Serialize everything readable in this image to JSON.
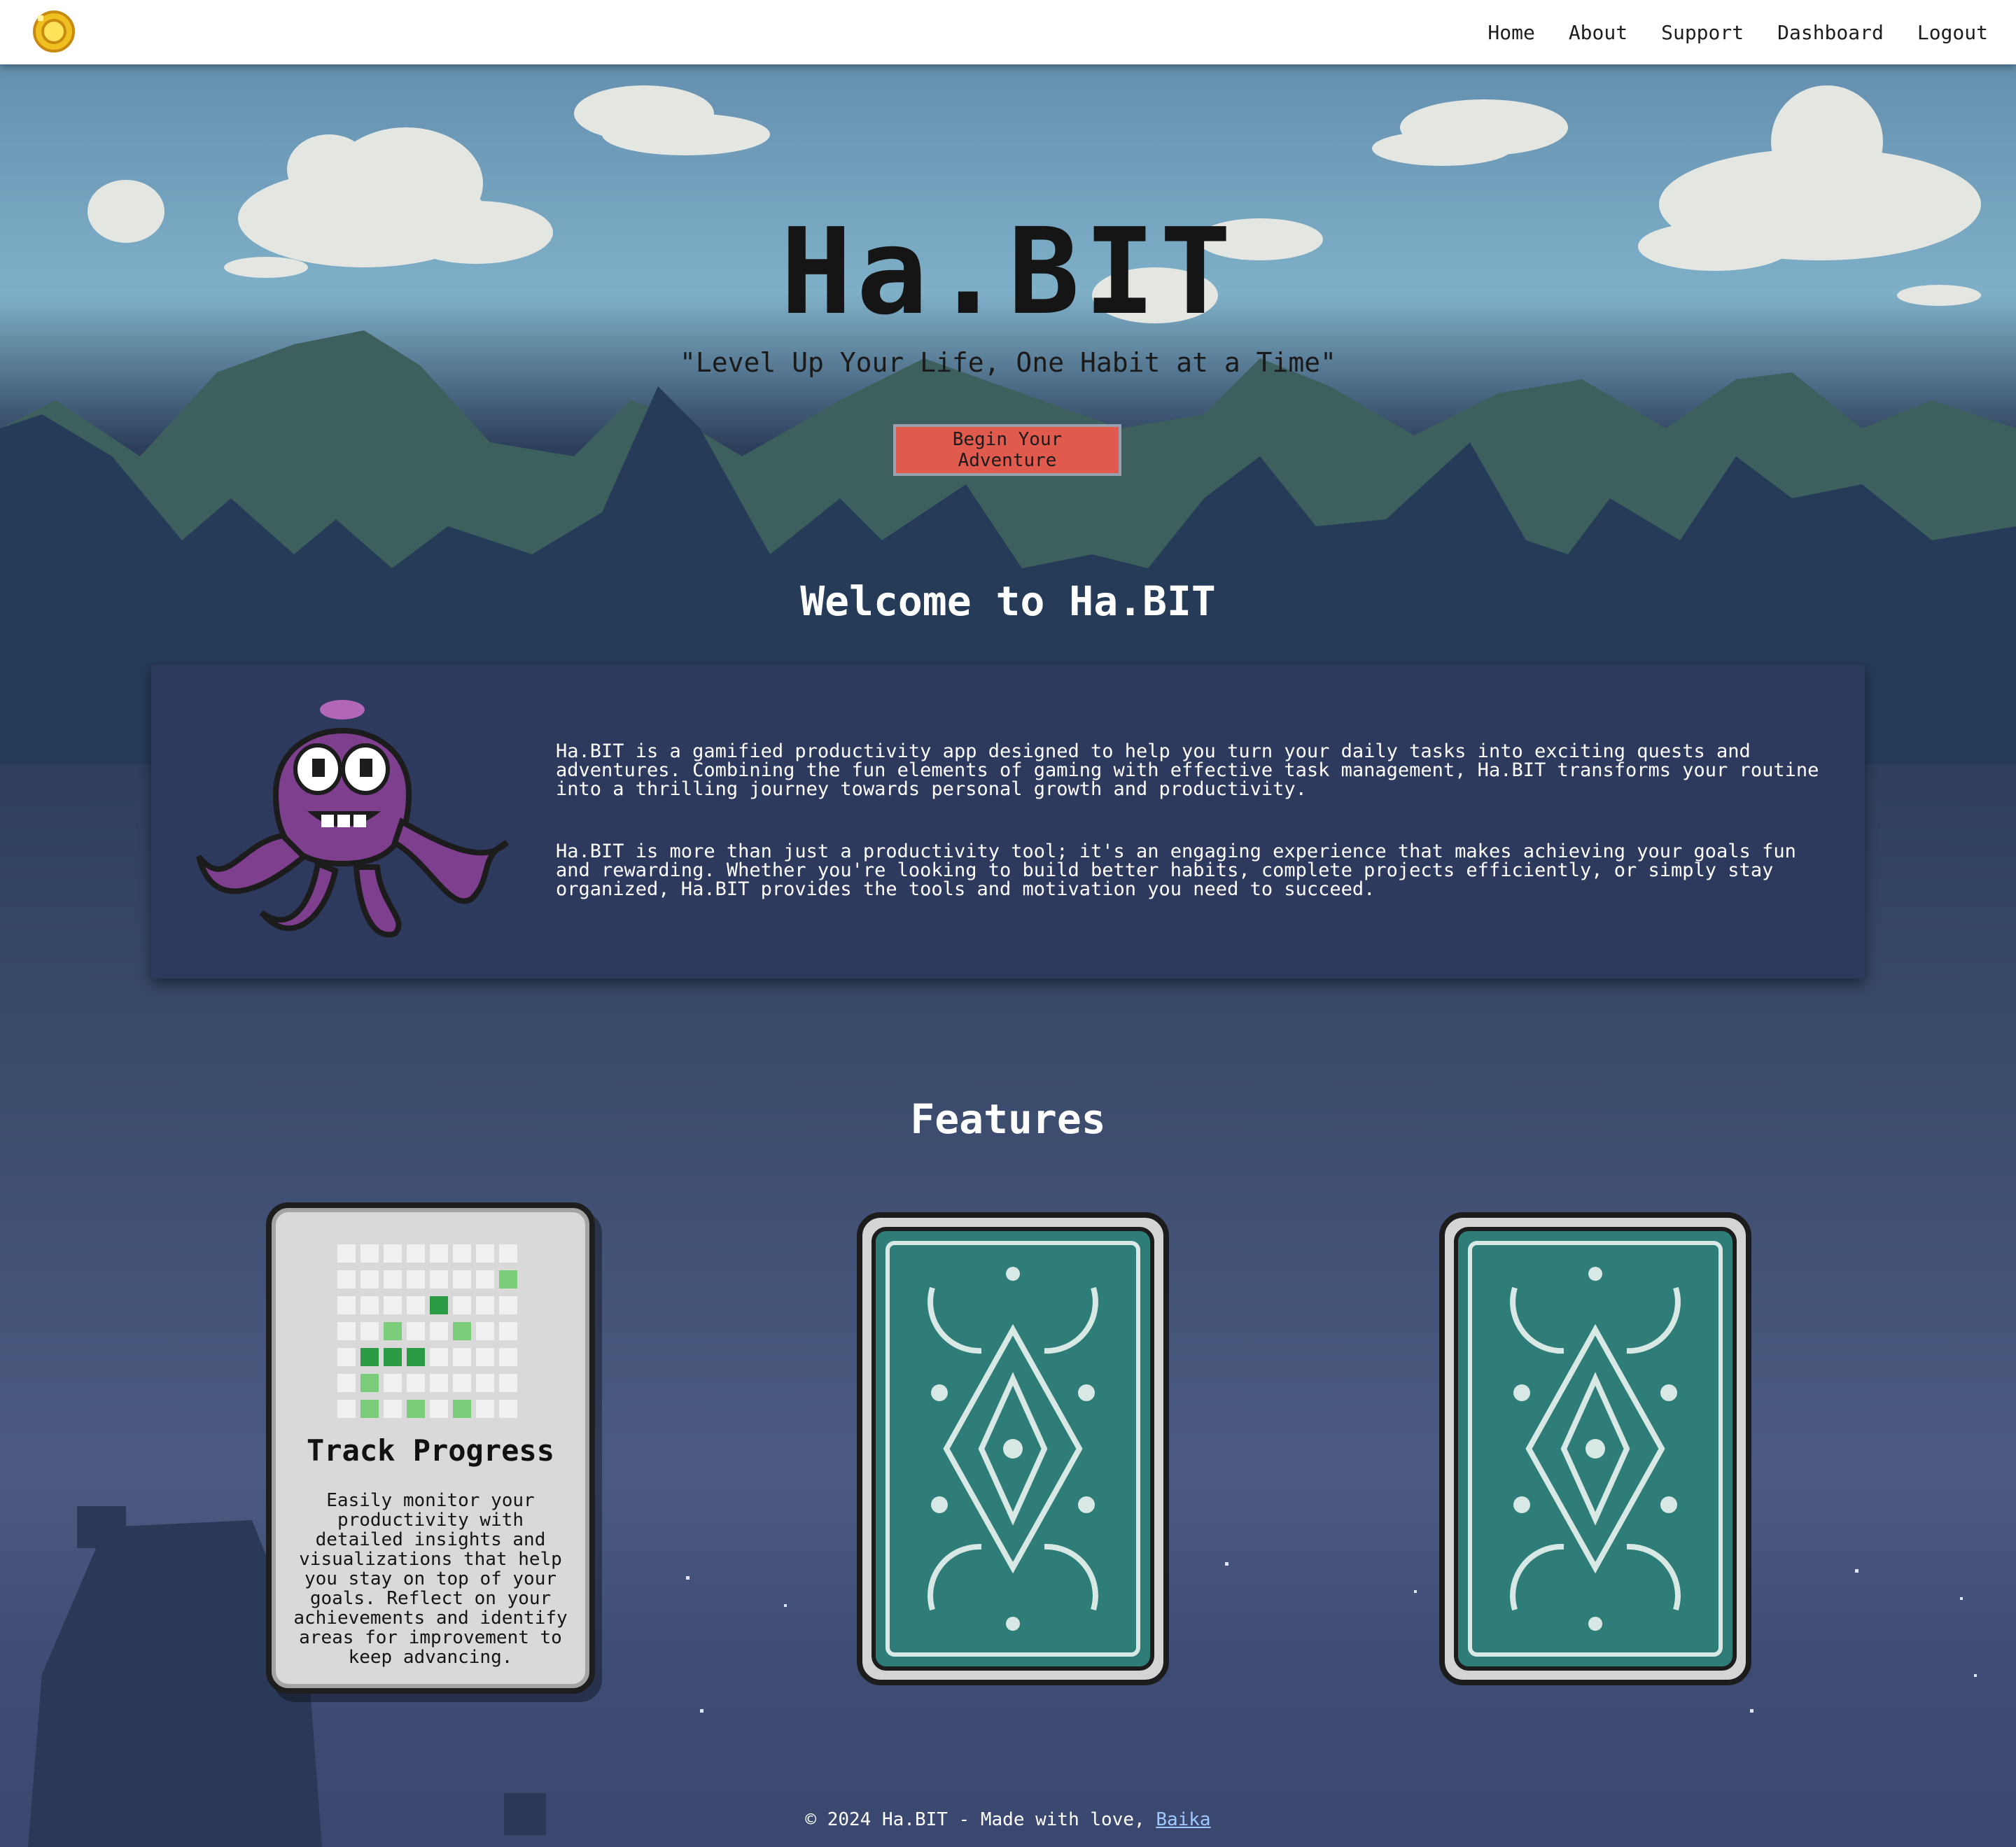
{
  "nav": {
    "logo_icon": "sun-coin-icon",
    "links": [
      "Home",
      "About",
      "Support",
      "Dashboard",
      "Logout"
    ]
  },
  "hero": {
    "title": "Ha.BIT",
    "tagline": "\"Level Up Your Life, One Habit at a Time\"",
    "cta": "Begin Your Adventure"
  },
  "welcome": {
    "title": "Welcome to Ha.BIT",
    "mascot_icon": "purple-octopus-icon",
    "paragraphs": [
      "Ha.BIT is a gamified productivity app designed to help you turn your daily tasks into exciting quests and adventures. Combining the fun elements of gaming with effective task management, Ha.BIT transforms your routine into a thrilling journey towards personal growth and productivity.",
      "Ha.BIT is more than just a productivity tool; it's an engaging experience that makes achieving your goals fun and rewarding. Whether you're looking to build better habits, complete projects efficiently, or simply stay organized, Ha.BIT provides the tools and motivation you need to succeed."
    ]
  },
  "features": {
    "title": "Features",
    "cards": [
      {
        "title": "Track Progress",
        "description": "Easily monitor your productivity with detailed insights and visualizations that help you stay on top of your goals. Reflect on your achievements and identify areas for improvement to keep advancing.",
        "icon": "progress-grid-icon"
      },
      {
        "icon": "card-back-icon"
      },
      {
        "icon": "card-back-icon"
      }
    ]
  },
  "footer": {
    "text": "© 2024 Ha.BIT - Made with love, ",
    "link": "Baika"
  },
  "colors": {
    "accent": "#e05b4e",
    "panel": "#2d3a5e",
    "card_back": "#2e7d78"
  }
}
